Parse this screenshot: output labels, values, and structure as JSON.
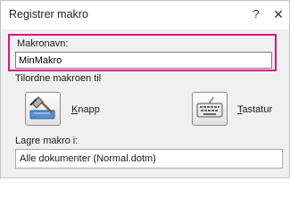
{
  "window": {
    "title": "Registrer makro",
    "help_glyph": "?",
    "close_glyph": "✕"
  },
  "macro_name": {
    "label": "Makronavn:",
    "value": "MinMakro"
  },
  "assign": {
    "label": "Tilordne makroen til",
    "button": {
      "accel": "K",
      "rest": "napp",
      "icon": "button-hammer-icon"
    },
    "keyboard": {
      "accel": "T",
      "rest": "astatur",
      "icon": "keyboard-icon"
    }
  },
  "store": {
    "label": "Lagre makro i:",
    "value": "Alle dokumenter (Normal.dotm)"
  },
  "colors": {
    "highlight": "#e0147f",
    "dialog_bg": "#f0f0f0"
  }
}
